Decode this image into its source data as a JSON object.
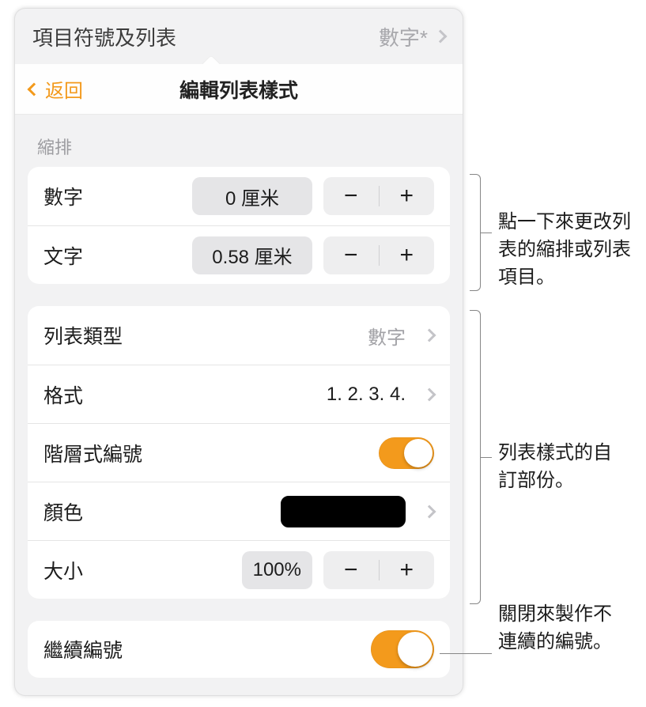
{
  "panel": {
    "breadcrumb_label": "項目符號及列表",
    "breadcrumb_value": "數字*"
  },
  "nav": {
    "back": "返回",
    "title": "編輯列表樣式"
  },
  "indent_section": {
    "header": "縮排",
    "number_label": "數字",
    "number_value": "0 厘米",
    "text_label": "文字",
    "text_value": "0.58 厘米"
  },
  "style_section": {
    "list_type_label": "列表類型",
    "list_type_value": "數字",
    "format_label": "格式",
    "format_value": "1. 2. 3. 4.",
    "tiered_label": "階層式編號",
    "color_label": "顏色",
    "size_label": "大小",
    "size_value": "100%"
  },
  "continue_section": {
    "continue_label": "繼續編號"
  },
  "annotations": {
    "indent": "點一下來更改列表的縮排或列表項目。",
    "style": "列表樣式的自訂部份。",
    "continue": "關閉來製作不連續的編號。"
  },
  "icons": {
    "minus": "−",
    "plus": "+"
  }
}
